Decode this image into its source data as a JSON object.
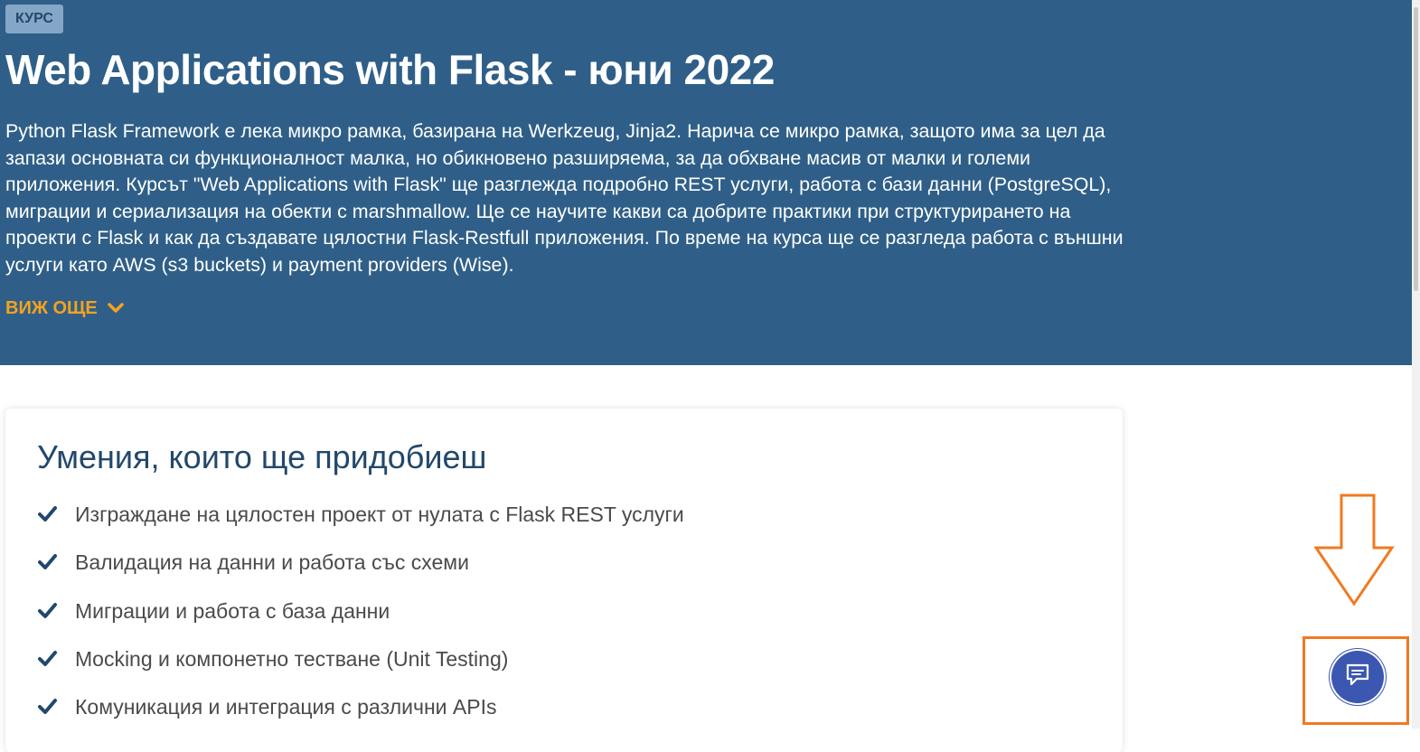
{
  "hero": {
    "badge": "КУРС",
    "title": "Web Applications with Flask - юни 2022",
    "description": "Python Flask Framework е лека микро рамка, базирана на Werkzeug, Jinja2. Нарича се микро рамка, защото има за цел да запази основната си функционалност малка, но обикновено разширяема, за да обхване масив от малки и големи приложения. Курсът \"Web Applications with Flask\" ще разглежда подробно REST услуги, работа с бази данни (PostgreSQL), миграции и сериализация на обекти с marshmallow. Ще се научите какви са добрите практики при структурирането на проекти с Flask и как да създавате цялостни Flask-Restfull приложения. По време на курса ще се разгледа работа с външни услуги като AWS (s3 buckets) и payment providers (Wise).",
    "see_more_label": "ВИЖ ОЩЕ",
    "see_more_icon": "chevron-down-icon"
  },
  "skills": {
    "title": "Умения, които ще придобиеш",
    "items": [
      {
        "label": "Изграждане на цялостен проект от нулата с Flask REST услуги"
      },
      {
        "label": "Валидация на данни и работа със схеми"
      },
      {
        "label": "Миграции и работа с база данни"
      },
      {
        "label": "Mocking и компонетно тестване (Unit Testing)"
      },
      {
        "label": "Комуникация и интеграция с различни APIs"
      }
    ],
    "item_icon": "checkmark-icon"
  },
  "chat": {
    "icon": "chat-bubble-icon"
  },
  "annotations": {
    "arrow_icon": "down-arrow-annotation",
    "highlight": "chat-highlight-box"
  },
  "colors": {
    "hero_bg": "#2f5f88",
    "badge_bg": "#84a7c7",
    "accent_orange": "#f6a21d",
    "heading_navy": "#22486b",
    "annotation_orange": "#f07a21",
    "chat_blue": "#3c57b1"
  }
}
